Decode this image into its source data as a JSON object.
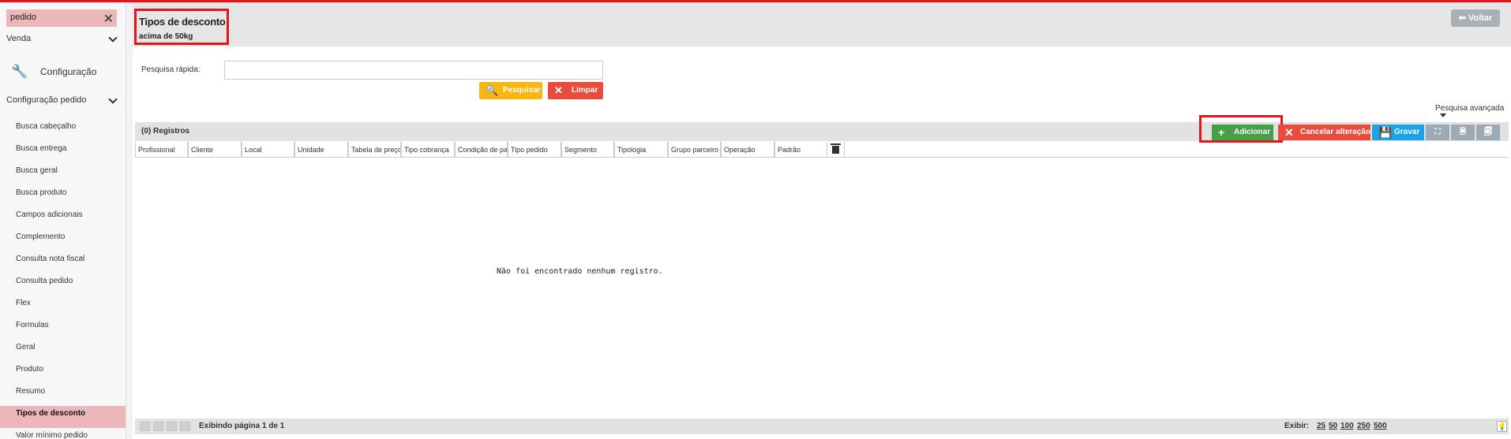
{
  "sidebar": {
    "search_value": "pedido",
    "venda_label": "Venda",
    "config_label": "Configuração",
    "config_pedido_label": "Configuração pedido",
    "items": [
      {
        "label": "Busca cabeçalho"
      },
      {
        "label": "Busca entrega"
      },
      {
        "label": "Busca geral"
      },
      {
        "label": "Busca produto"
      },
      {
        "label": "Campos adicionais"
      },
      {
        "label": "Complemento"
      },
      {
        "label": "Consulta nota fiscal"
      },
      {
        "label": "Consulta pedido"
      },
      {
        "label": "Flex"
      },
      {
        "label": "Formulas"
      },
      {
        "label": "Geral"
      },
      {
        "label": "Produto"
      },
      {
        "label": "Resumo"
      },
      {
        "label": "Tipos de desconto",
        "active": true
      },
      {
        "label": "Valor mínimo pedido"
      }
    ]
  },
  "header": {
    "title": "Tipos de desconto",
    "subtitle": "acima de 50kg",
    "back_label": "Voltar"
  },
  "search": {
    "label": "Pesquisa rápida:",
    "value": "",
    "search_button": "Pesquisar",
    "clear_button": "Limpar",
    "advanced_label": "Pesquisa avançada"
  },
  "grid": {
    "records_label": "(0) Registros",
    "toolbar": {
      "add": "Adicionar",
      "cancel": "Cancelar alteração",
      "save": "Gravar"
    },
    "columns": [
      "Profissional",
      "Cliente",
      "Local",
      "Unidade",
      "Tabela de preço",
      "Tipo cobrança",
      "Condição de pag...",
      "Tipo pedido",
      "Segmento",
      "Tipologia",
      "Grupo parceiro",
      "Operação",
      "Padrão"
    ],
    "empty_message": "Não foi encontrado nenhum registro."
  },
  "footer": {
    "page_info": "Exibindo página 1 de 1",
    "show_label": "Exibir:",
    "page_sizes": [
      "25",
      "50",
      "100",
      "250",
      "500"
    ]
  },
  "colors": {
    "highlight_red": "#e8141b",
    "active_item_bg": "#ebb7b8",
    "add_green": "#43a047",
    "cancel_red": "#e74c3c",
    "save_blue": "#1ba3e8",
    "search_yellow": "#f6b713"
  }
}
